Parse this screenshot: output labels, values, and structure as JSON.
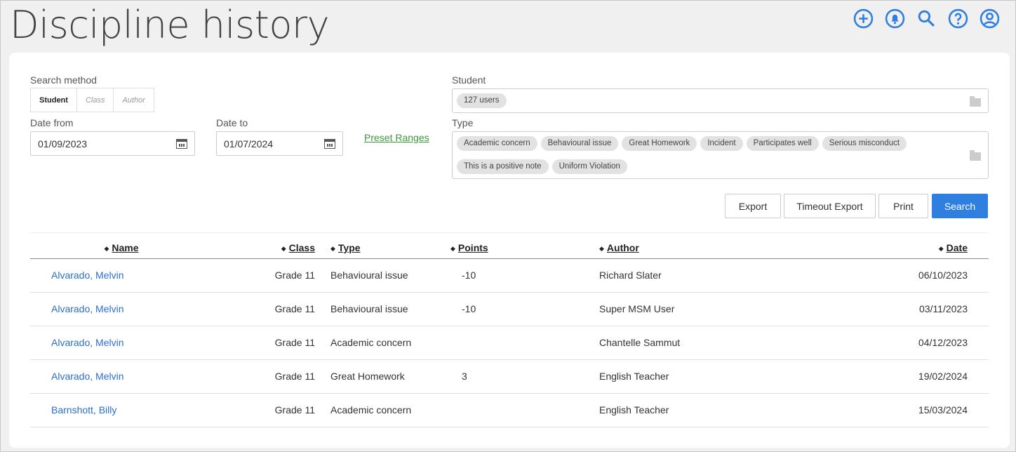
{
  "title": "Discipline history",
  "top_icons": [
    "add-circle-icon",
    "bell-icon",
    "search-icon",
    "help-icon",
    "user-icon"
  ],
  "form": {
    "search_method_label": "Search method",
    "methods": [
      "Student",
      "Class",
      "Author"
    ],
    "date_from_label": "Date from",
    "date_from": "01/09/2023",
    "date_to_label": "Date to",
    "date_to": "01/07/2024",
    "preset_ranges": "Preset Ranges",
    "student_label": "Student",
    "student_tags": [
      "127 users"
    ],
    "type_label": "Type",
    "type_tags": [
      "Academic concern",
      "Behavioural issue",
      "Great Homework",
      "Incident",
      "Participates well",
      "Serious misconduct",
      "This is a positive note",
      "Uniform Violation"
    ]
  },
  "buttons": {
    "export": "Export",
    "timeout_export": "Timeout Export",
    "print": "Print",
    "search": "Search"
  },
  "table": {
    "columns": [
      "Name",
      "Class",
      "Type",
      "Points",
      "Author",
      "Date"
    ],
    "rows": [
      [
        "Alvarado, Melvin",
        "Grade 11",
        "Behavioural issue",
        "-10",
        "Richard Slater",
        "06/10/2023"
      ],
      [
        "Alvarado, Melvin",
        "Grade 11",
        "Behavioural issue",
        "-10",
        "Super MSM User",
        "03/11/2023"
      ],
      [
        "Alvarado, Melvin",
        "Grade 11",
        "Academic concern",
        "",
        "Chantelle Sammut",
        "04/12/2023"
      ],
      [
        "Alvarado, Melvin",
        "Grade 11",
        "Great Homework",
        "3",
        "English Teacher",
        "19/02/2024"
      ],
      [
        "Barnshott, Billy",
        "Grade 11",
        "Academic concern",
        "",
        "English Teacher",
        "15/03/2024"
      ]
    ]
  },
  "colors": {
    "accent": "#2f7fe0",
    "link": "#2a6fd0",
    "preset": "#3a9a3a"
  }
}
